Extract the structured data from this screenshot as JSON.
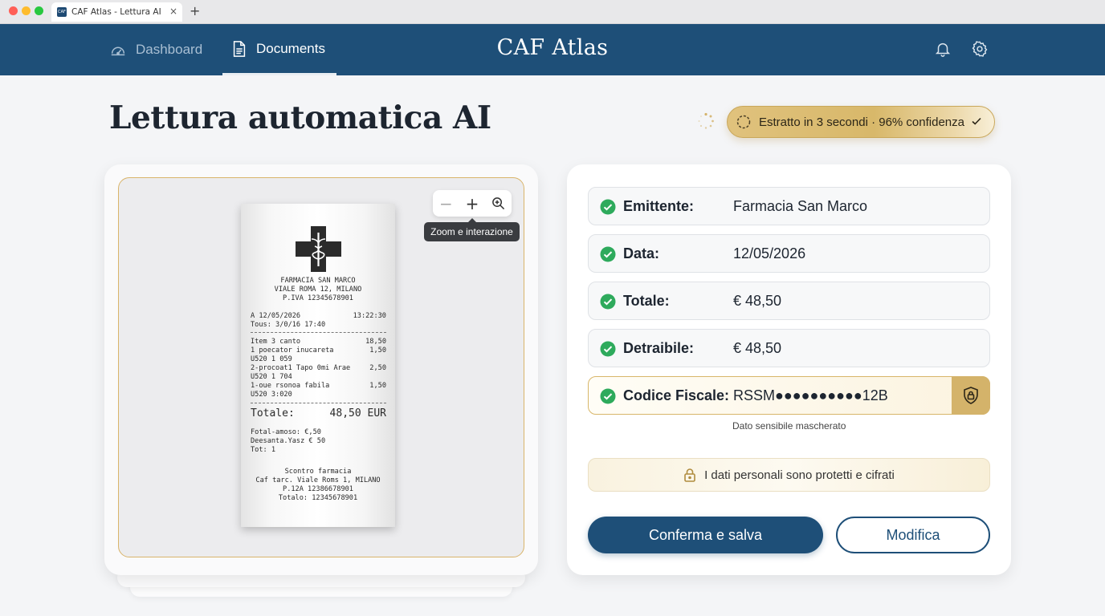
{
  "browser": {
    "tab_title": "CAF Atlas - Lettura AI",
    "tab_close": "×",
    "new_tab": "+",
    "favicon_text": "CAF"
  },
  "header": {
    "brand": "CAF Atlas",
    "nav": [
      {
        "label": "Dashboard",
        "icon": "speedometer-icon",
        "active": false
      },
      {
        "label": "Documents",
        "icon": "document-icon",
        "active": true
      }
    ],
    "icons": [
      "bell-icon",
      "gear-icon"
    ]
  },
  "page": {
    "title": "Lettura automatica AI",
    "status": "Estratto in 3 secondi · 96% confidenza"
  },
  "viewer": {
    "zoom_out": "−",
    "zoom_in": "+",
    "tooltip": "Zoom e interazione"
  },
  "receipt": {
    "header_lines": [
      "FARMACIA SAN MARCO",
      "VIALE ROMA 12, MILANO",
      "P.IVA 12345678901"
    ],
    "date_left": "A 12/05/2026",
    "date_right": "13:22:30",
    "sub_line": "Tous: 3/0/16 17:40",
    "items": [
      {
        "name": "Item 3 canto",
        "price": "18,50"
      },
      {
        "name": "1 poecator inucareta",
        "price": "1,50"
      },
      {
        "name": "U520 1 059",
        "price": ""
      },
      {
        "name": "2-procoat1 Tapo 0mi Arae",
        "price": "2,50"
      },
      {
        "name": "U520 1 704",
        "price": ""
      },
      {
        "name": "1-oue rsonoa fabila",
        "price": "1,50"
      },
      {
        "name": "U520 3:020",
        "price": ""
      }
    ],
    "total_label": "Totale:",
    "total_value": "48,50 EUR",
    "footer_small": [
      "Fotal-amoso: €,50",
      "Deesanta.Yasz € 50",
      "Tot: 1"
    ],
    "footer_center": [
      "Scontro farmacia",
      "Caf tarc. Viale Roms 1, MILANO",
      "P.12A 12386678901",
      "Totalo: 12345678901"
    ]
  },
  "fields": [
    {
      "label": "Emittente:",
      "value": "Farmacia San Marco"
    },
    {
      "label": "Data:",
      "value": "12/05/2026"
    },
    {
      "label": "Totale:",
      "value": "€ 48,50"
    },
    {
      "label": "Detraibile:",
      "value": "€ 48,50"
    },
    {
      "label": "Codice Fiscale:",
      "value": "RSSM●●●●●●●●●●12B"
    }
  ],
  "masked_note": "Dato sensibile mascherato",
  "privacy_note": "I dati personali sono protetti e cifrati",
  "actions": {
    "confirm": "Conferma e salva",
    "edit": "Modifica"
  },
  "colors": {
    "primary": "#1e4f78",
    "gold": "#d4b36a",
    "success": "#2eaa5c"
  }
}
